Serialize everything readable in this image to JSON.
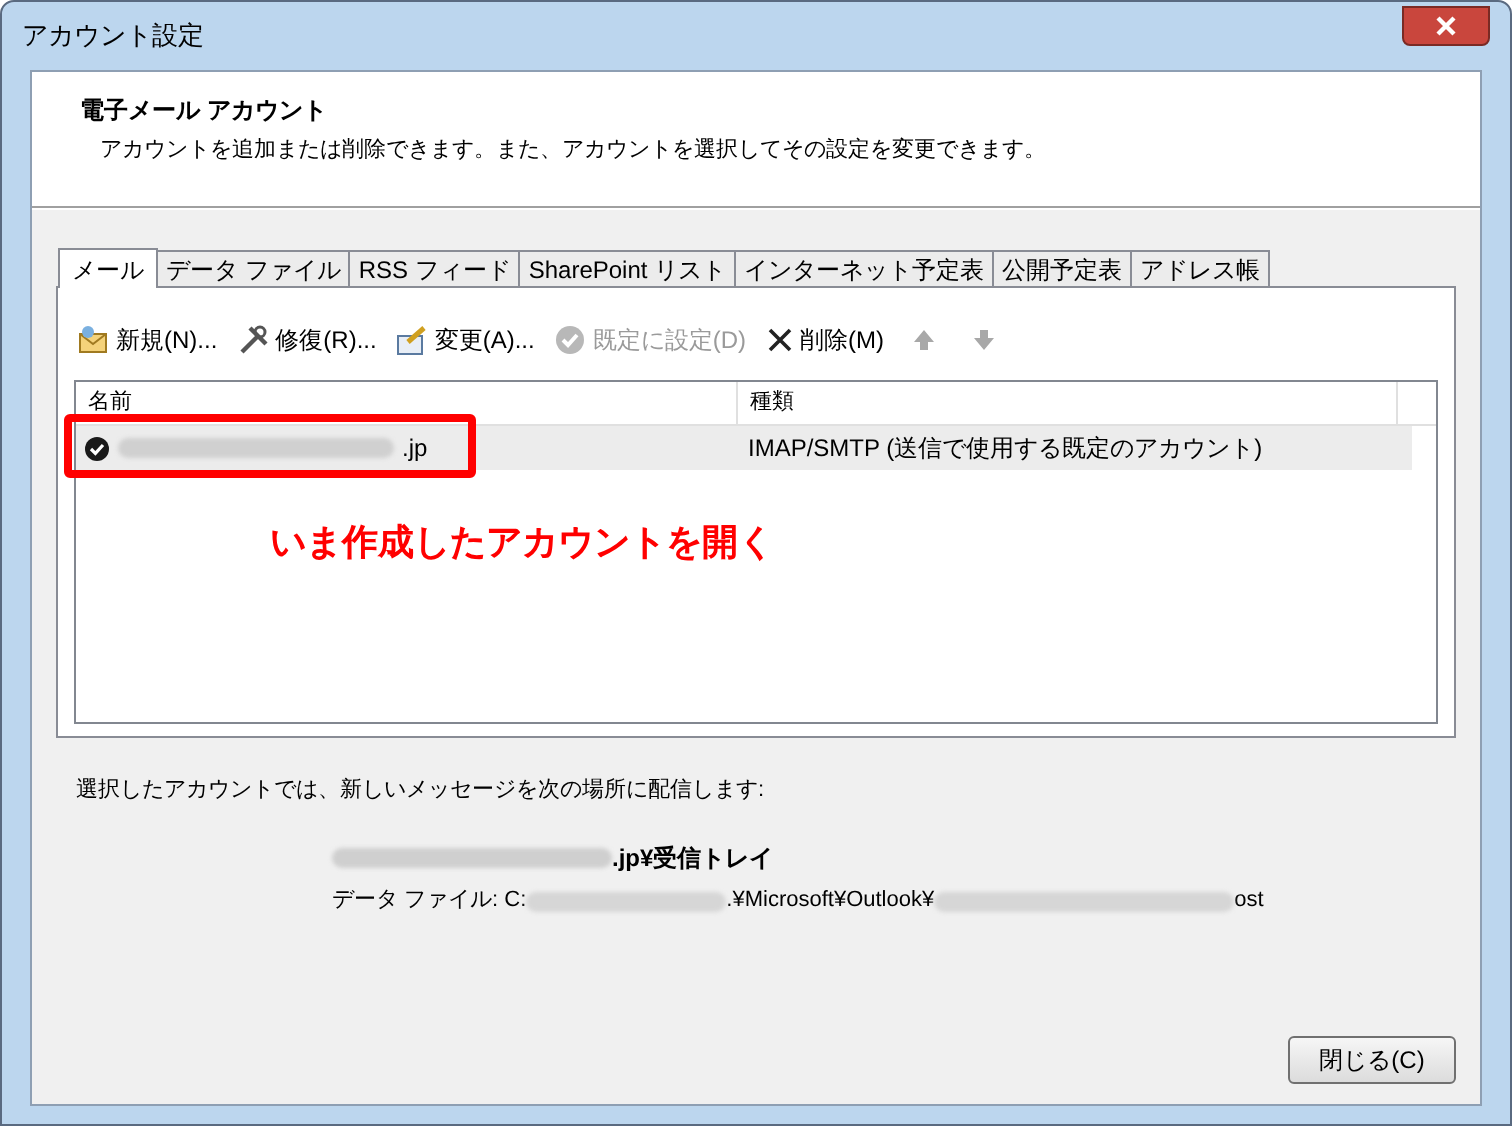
{
  "window": {
    "title": "アカウント設定"
  },
  "header": {
    "title": "電子メール アカウント",
    "description": "アカウントを追加または削除できます。また、アカウントを選択してその設定を変更できます。"
  },
  "tabs": [
    {
      "label": "メール",
      "selected": true
    },
    {
      "label": "データ ファイル",
      "selected": false
    },
    {
      "label": "RSS フィード",
      "selected": false
    },
    {
      "label": "SharePoint リスト",
      "selected": false
    },
    {
      "label": "インターネット予定表",
      "selected": false
    },
    {
      "label": "公開予定表",
      "selected": false
    },
    {
      "label": "アドレス帳",
      "selected": false
    }
  ],
  "toolbar": [
    {
      "kind": "new",
      "label": "新規(N)...",
      "disabled": false
    },
    {
      "kind": "repair",
      "label": "修復(R)...",
      "disabled": false
    },
    {
      "kind": "change",
      "label": "変更(A)...",
      "disabled": false
    },
    {
      "kind": "default",
      "label": "既定に設定(D)",
      "disabled": true
    },
    {
      "kind": "delete",
      "label": "削除(M)",
      "disabled": false
    },
    {
      "kind": "up",
      "disabled": true
    },
    {
      "kind": "down",
      "disabled": true
    }
  ],
  "accounts": {
    "columns": [
      "名前",
      "種類"
    ],
    "rows": [
      {
        "name": ".jp",
        "type": "IMAP/SMTP (送信で使用する既定のアカウント)",
        "selected": true,
        "default": true
      }
    ]
  },
  "annotation": {
    "text": "いま作成したアカウントを開く"
  },
  "delivery": {
    "label": "選択したアカウントでは、新しいメッセージを次の場所に配信します:",
    "folder": ".jp¥受信トレイ",
    "data_file_label": "データ ファイル: C:",
    "data_file_path": ".¥Microsoft¥Outlook¥",
    "data_file_ext": "ost"
  },
  "buttons": [
    {
      "label": "閉じる(C)"
    }
  ]
}
